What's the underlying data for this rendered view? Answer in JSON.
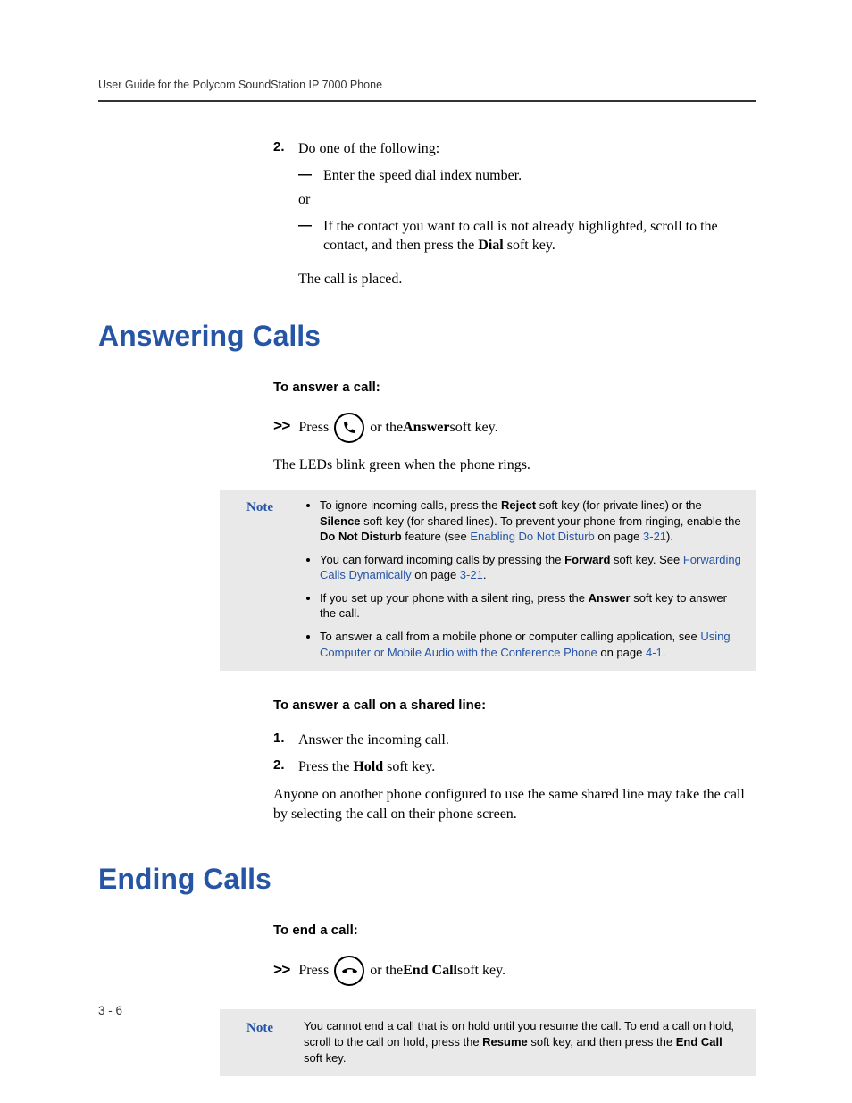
{
  "header": {
    "running_title": "User Guide for the Polycom SoundStation IP 7000 Phone"
  },
  "intro": {
    "step2_num": "2.",
    "step2_text": "Do one of the following:",
    "sub_a": "Enter the speed dial index number.",
    "or": "or",
    "sub_b_prefix": "If the contact you want to call is not already highlighted, scroll to the contact, and then press the ",
    "sub_b_bold": "Dial",
    "sub_b_suffix": " soft key.",
    "placed": "The call is placed."
  },
  "answering": {
    "heading": "Answering Calls",
    "subhead": "To answer a call:",
    "press_prefix": "Press",
    "press_mid": " or the ",
    "press_bold": "Answer",
    "press_suffix": " soft key.",
    "leds": "The LEDs blink green when the phone rings.",
    "note_label": "Note",
    "note": {
      "b1_a": "To ignore incoming calls, press the ",
      "b1_bold1": "Reject",
      "b1_b": " soft key (for private lines) or the ",
      "b1_bold2": "Silence",
      "b1_c": " soft key (for shared lines). To prevent your phone from ringing, enable the ",
      "b1_bold3": "Do Not Disturb",
      "b1_d": " feature (see ",
      "b1_link": "Enabling Do Not Disturb",
      "b1_e": " on page ",
      "b1_page": "3-21",
      "b1_f": ").",
      "b2_a": "You can forward incoming calls by pressing the ",
      "b2_bold": "Forward",
      "b2_b": " soft key. See ",
      "b2_link": "Forwarding Calls Dynamically",
      "b2_c": " on page ",
      "b2_page": "3-21",
      "b2_d": ".",
      "b3_a": "If you set up your phone with a silent ring, press the ",
      "b3_bold": "Answer",
      "b3_b": " soft key to answer the call.",
      "b4_a": "To answer a call from a mobile phone or computer calling application, see ",
      "b4_link": "Using Computer or Mobile Audio with the Conference Phone",
      "b4_b": " on page ",
      "b4_page": "4-1",
      "b4_c": "."
    },
    "shared_subhead": "To answer a call on a shared line:",
    "shared_s1_num": "1.",
    "shared_s1": "Answer the incoming call.",
    "shared_s2_num": "2.",
    "shared_s2_a": "Press the ",
    "shared_s2_bold": "Hold",
    "shared_s2_b": " soft key.",
    "shared_para": "Anyone on another phone configured to use the same shared line may take the call by selecting the call on their phone screen."
  },
  "ending": {
    "heading": "Ending Calls",
    "subhead": "To end a call:",
    "press_prefix": "Press",
    "press_mid": " or the ",
    "press_bold": "End Call",
    "press_suffix": " soft key.",
    "note_label": "Note",
    "note_a": "You cannot end a call that is on hold until you resume the call. To end a call on hold, scroll to the call on hold, press the ",
    "note_bold1": "Resume",
    "note_b": " soft key, and then press the ",
    "note_bold2": "End Call",
    "note_c": " soft key."
  },
  "footer": {
    "page_num": "3 - 6"
  }
}
